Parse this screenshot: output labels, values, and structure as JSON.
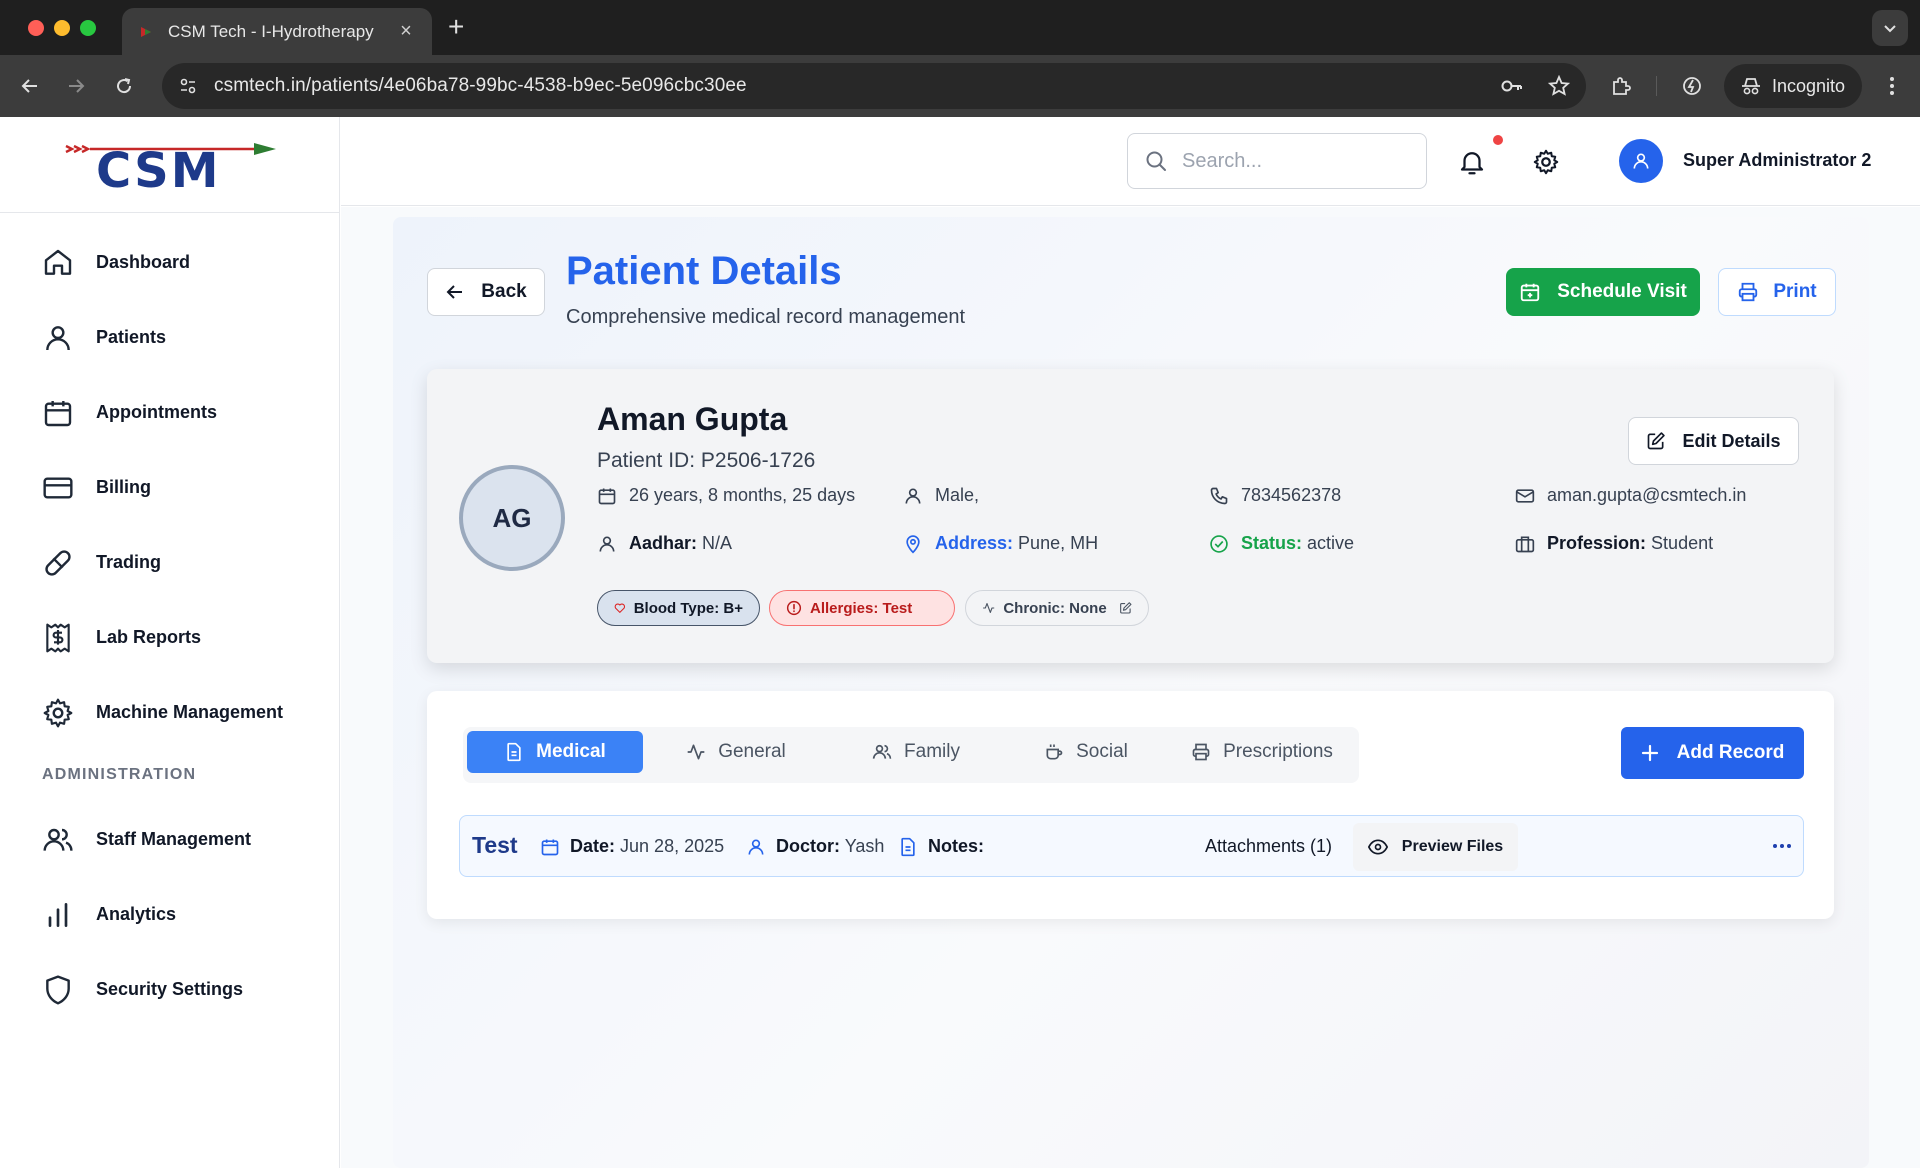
{
  "browser": {
    "tab_title": "CSM Tech - I-Hydrotherapy",
    "url": "csmtech.in/patients/4e06ba78-99bc-4538-b9ec-5e096cbc30ee",
    "incognito_label": "Incognito"
  },
  "brand": {
    "logo_text": "CSM",
    "colors": {
      "red": "#d32f2f",
      "blue": "#1e3a8a",
      "green": "#2e7d32"
    }
  },
  "sidebar": {
    "items": [
      {
        "label": "Dashboard",
        "icon": "home-icon"
      },
      {
        "label": "Patients",
        "icon": "user-icon"
      },
      {
        "label": "Appointments",
        "icon": "calendar-icon"
      },
      {
        "label": "Billing",
        "icon": "credit-card-icon"
      },
      {
        "label": "Trading",
        "icon": "pill-icon"
      },
      {
        "label": "Lab Reports",
        "icon": "receipt-icon"
      },
      {
        "label": "Machine Management",
        "icon": "gear-icon"
      }
    ],
    "admin_section_label": "ADMINISTRATION",
    "admin_items": [
      {
        "label": "Staff Management",
        "icon": "users-icon"
      },
      {
        "label": "Analytics",
        "icon": "bar-chart-icon"
      },
      {
        "label": "Security Settings",
        "icon": "shield-icon"
      }
    ]
  },
  "header": {
    "search_placeholder": "Search...",
    "user_name": "Super Administrator 2",
    "has_notification": true
  },
  "page": {
    "back_label": "Back",
    "title": "Patient Details",
    "subtitle": "Comprehensive medical record management",
    "schedule_label": "Schedule Visit",
    "print_label": "Print"
  },
  "patient": {
    "initials": "AG",
    "name": "Aman Gupta",
    "patient_id": "Patient ID: P2506-1726",
    "edit_label": "Edit Details",
    "age": "26 years, 8 months, 25 days",
    "gender": "Male,",
    "phone": "7834562378",
    "email": "aman.gupta@csmtech.in",
    "aadhar_label": "Aadhar:",
    "aadhar_value": "N/A",
    "address_label": "Address:",
    "address_value": "Pune, MH",
    "status_label": "Status:",
    "status_value": "active",
    "profession_label": "Profession:",
    "profession_value": "Student",
    "chips": {
      "blood": "Blood Type: B+",
      "allergies": "Allergies: Test",
      "chronic": "Chronic: None"
    }
  },
  "records": {
    "tabs": [
      {
        "label": "Medical",
        "active": true
      },
      {
        "label": "General",
        "active": false
      },
      {
        "label": "Family",
        "active": false
      },
      {
        "label": "Social",
        "active": false
      },
      {
        "label": "Prescriptions",
        "active": false
      }
    ],
    "add_label": "Add Record",
    "rows": [
      {
        "title": "Test",
        "date_label": "Date:",
        "date_value": "Jun 28, 2025",
        "doctor_label": "Doctor:",
        "doctor_value": "Yash",
        "notes_label": "Notes:",
        "attachments": "Attachments (1)",
        "preview_label": "Preview Files"
      }
    ]
  }
}
